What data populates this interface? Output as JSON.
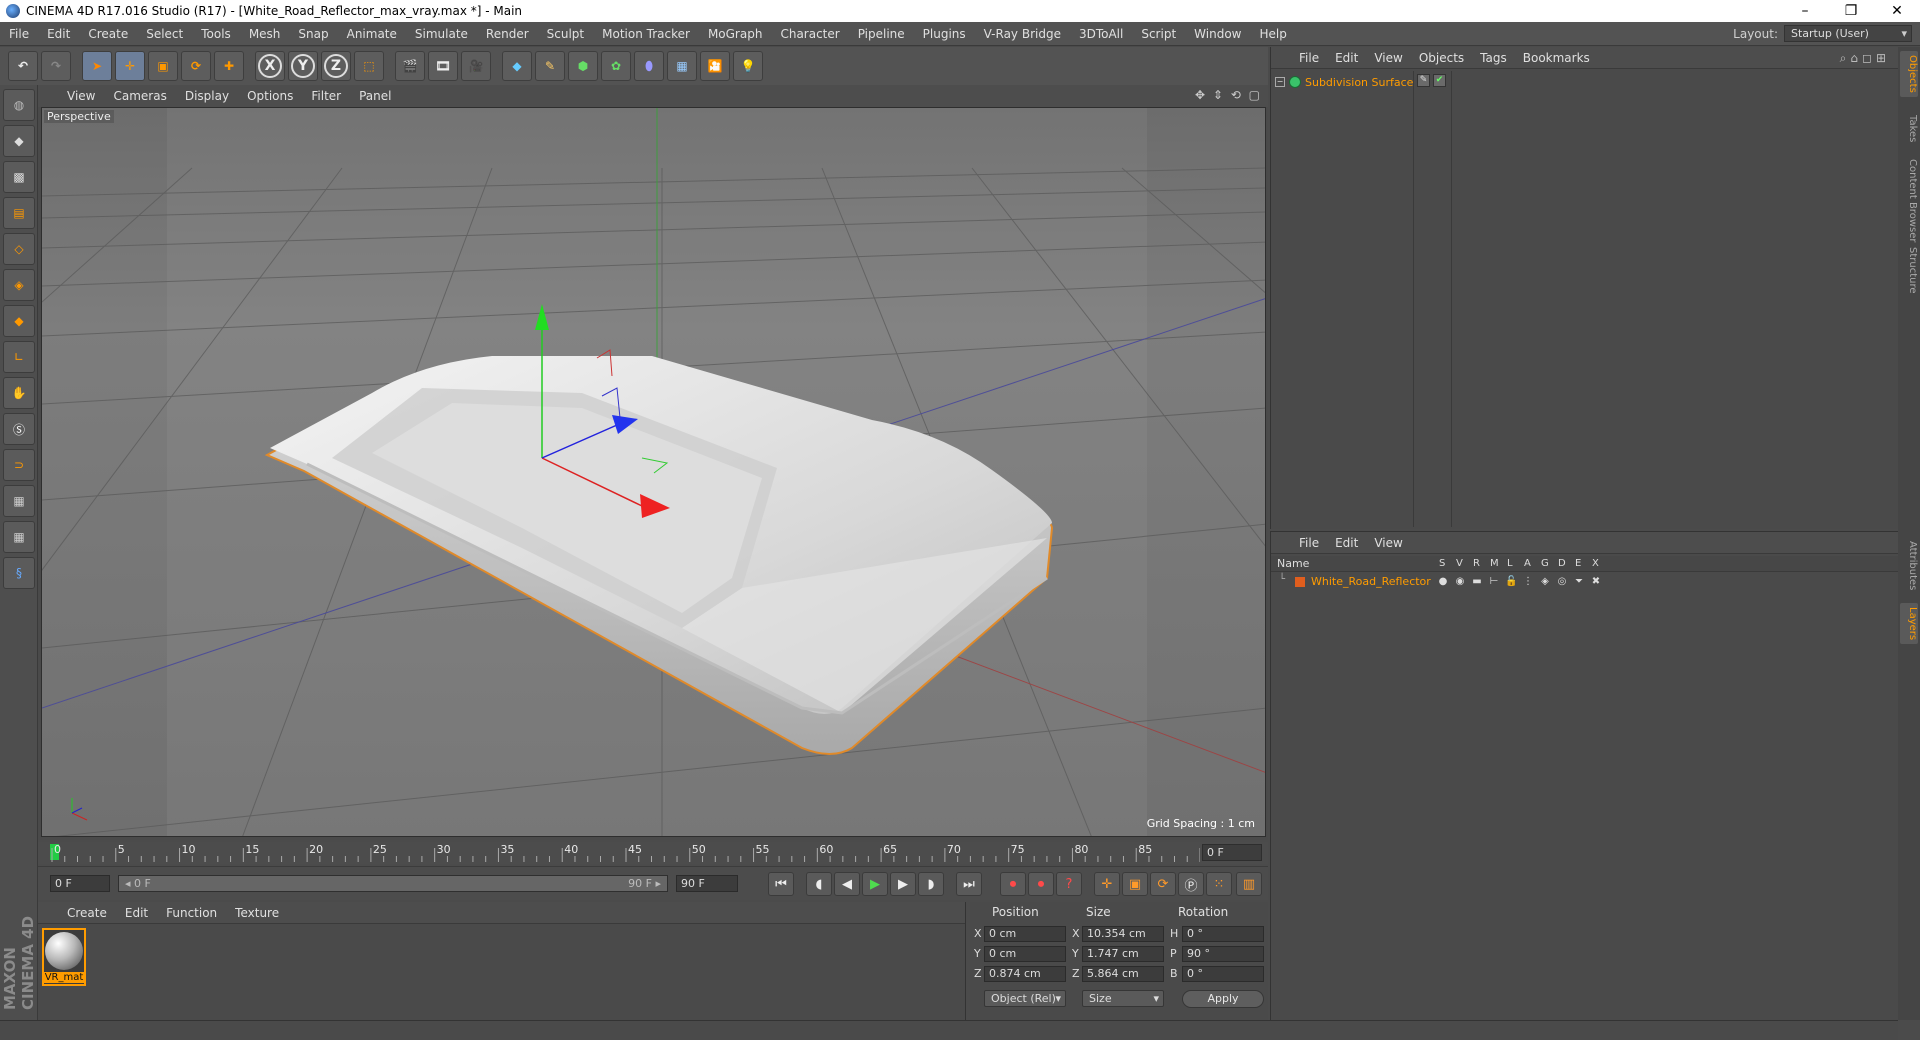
{
  "window": {
    "title": "CINEMA 4D R17.016 Studio (R17) - [White_Road_Reflector_max_vray.max *] - Main",
    "controls": [
      "–",
      "❐",
      "✕"
    ]
  },
  "menubar": {
    "items": [
      "File",
      "Edit",
      "Create",
      "Select",
      "Tools",
      "Mesh",
      "Snap",
      "Animate",
      "Simulate",
      "Render",
      "Sculpt",
      "Motion Tracker",
      "MoGraph",
      "Character",
      "Pipeline",
      "Plugins",
      "V-Ray Bridge",
      "3DToAll",
      "Script",
      "Window",
      "Help"
    ],
    "layout_label": "Layout:",
    "layout_value": "Startup (User)"
  },
  "toolbar": {
    "axis_x": "X",
    "axis_y": "Y",
    "axis_z": "Z"
  },
  "viewport": {
    "menu": [
      "View",
      "Cameras",
      "Display",
      "Options",
      "Filter",
      "Panel"
    ],
    "label": "Perspective",
    "grid_spacing": "Grid Spacing : 1 cm"
  },
  "timeline": {
    "ticks": [
      "0",
      "5",
      "10",
      "15",
      "20",
      "25",
      "30",
      "35",
      "40",
      "45",
      "50",
      "55",
      "60",
      "65",
      "70",
      "75",
      "80",
      "85",
      "90"
    ],
    "current_frame": "0 F"
  },
  "transport": {
    "start_frame": "0 F",
    "slider_start": "◂ 0 F",
    "slider_end": "90 F ▸",
    "end_frame": "90 F"
  },
  "material_manager": {
    "menu": [
      "Create",
      "Edit",
      "Function",
      "Texture"
    ],
    "material_name": "VR_mat"
  },
  "coordinates": {
    "headers": {
      "position": "Position",
      "size": "Size",
      "rotation": "Rotation"
    },
    "rows": [
      {
        "axis": "X",
        "pos": "0 cm",
        "size_axis": "X",
        "size": "10.354 cm",
        "rot_axis": "H",
        "rot": "0 °"
      },
      {
        "axis": "Y",
        "pos": "0 cm",
        "size_axis": "Y",
        "size": "1.747 cm",
        "rot_axis": "P",
        "rot": "90 °"
      },
      {
        "axis": "Z",
        "pos": "0.874 cm",
        "size_axis": "Z",
        "size": "5.864 cm",
        "rot_axis": "B",
        "rot": "0 °"
      }
    ],
    "mode": "Object (Rel)",
    "size_mode": "Size",
    "apply": "Apply"
  },
  "object_manager": {
    "menu": [
      "File",
      "Edit",
      "View",
      "Objects",
      "Tags",
      "Bookmarks"
    ],
    "object_name": "Subdivision Surface"
  },
  "layer_manager": {
    "menu": [
      "File",
      "Edit",
      "View"
    ],
    "name_header": "Name",
    "flags": [
      "S",
      "V",
      "R",
      "M",
      "L",
      "A",
      "G",
      "D",
      "E",
      "X"
    ],
    "layer_name": "White_Road_Reflector"
  },
  "right_tabs": [
    "Objects",
    "Takes",
    "Content Browser",
    "Structure",
    "Attributes",
    "Layers"
  ],
  "branding": "MAXON CINEMA 4D"
}
